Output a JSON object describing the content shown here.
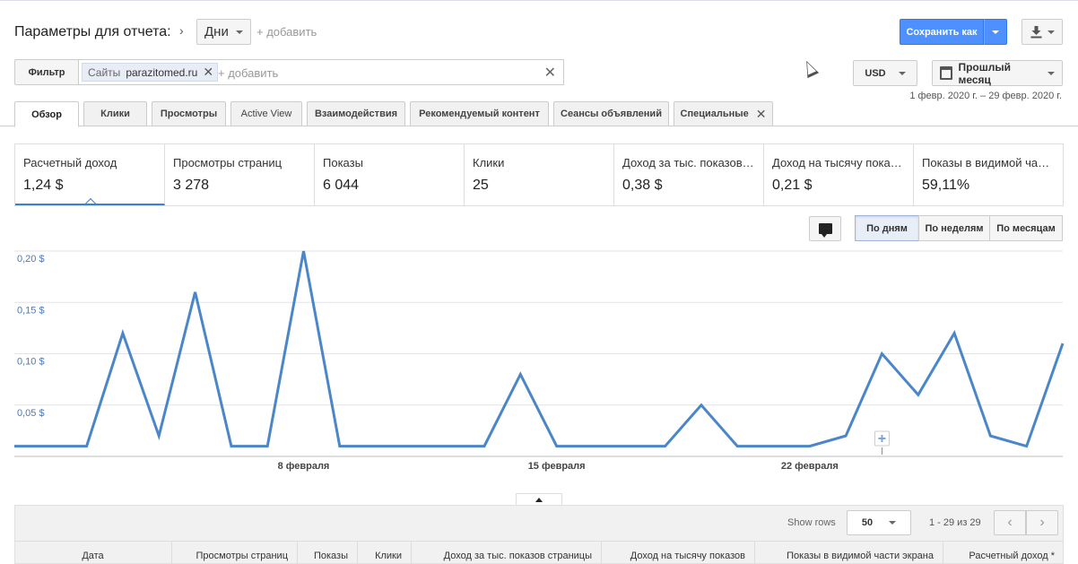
{
  "header": {
    "title": "Параметры для отчета:",
    "dimension_dropdown": "Дни",
    "add_label": "+ добавить",
    "save_as_label": "Сохранить как"
  },
  "filter": {
    "button_label": "Фильтр",
    "chip_label": "Сайты",
    "chip_value": "parazitomed.ru",
    "add_label": "+ добавить"
  },
  "currency": "USD",
  "period": {
    "label": "Прошлый месяц",
    "range": "1 февр. 2020 г. – 29 февр. 2020 г."
  },
  "tabs": [
    {
      "label": "Обзор"
    },
    {
      "label": "Клики"
    },
    {
      "label": "Просмотры"
    },
    {
      "label": "Active View"
    },
    {
      "label": "Взаимодействия"
    },
    {
      "label": "Рекомендуемый контент"
    },
    {
      "label": "Сеансы объявлений"
    },
    {
      "label": "Специальные"
    }
  ],
  "metrics": [
    {
      "name": "Расчетный доход",
      "value": "1,24 $"
    },
    {
      "name": "Просмотры страниц",
      "value": "3 278"
    },
    {
      "name": "Показы",
      "value": "6 044"
    },
    {
      "name": "Клики",
      "value": "25"
    },
    {
      "name": "Доход за тыс. показов страницы",
      "value": "0,38 $"
    },
    {
      "name": "Доход на тысячу показов",
      "value": "0,21 $"
    },
    {
      "name": "Показы в видимой части экрана",
      "value": "59,11%"
    }
  ],
  "granularity": {
    "day": "По дням",
    "week": "По неделям",
    "month": "По месяцам"
  },
  "colors": {
    "accent": "#4d90fe",
    "line": "#4a86c8",
    "axis_text": "#4a7ab8"
  },
  "chart_data": {
    "type": "line",
    "title": "",
    "xlabel": "",
    "ylabel": "",
    "ylim": [
      0,
      0.2
    ],
    "y_ticks": [
      {
        "value": 0.2,
        "label": "0,20 $"
      },
      {
        "value": 0.15,
        "label": "0,15 $"
      },
      {
        "value": 0.1,
        "label": "0,10 $"
      },
      {
        "value": 0.05,
        "label": "0,05 $"
      }
    ],
    "x_ticks": [
      {
        "day": 8,
        "label": "8 февраля"
      },
      {
        "day": 15,
        "label": "15 февраля"
      },
      {
        "day": 22,
        "label": "22 февраля"
      }
    ],
    "x": [
      1,
      2,
      3,
      4,
      5,
      6,
      7,
      8,
      9,
      10,
      11,
      12,
      13,
      14,
      15,
      16,
      17,
      18,
      19,
      20,
      21,
      22,
      23,
      24,
      25,
      26,
      27,
      28,
      29
    ],
    "series": [
      {
        "values": [
          0.01,
          0.01,
          0.01,
          0.12,
          0.02,
          0.16,
          0.01,
          0.01,
          0.2,
          0.01,
          0.01,
          0.01,
          0.01,
          0.01,
          0.08,
          0.01,
          0.01,
          0.01,
          0.01,
          0.05,
          0.01,
          0.01,
          0.01,
          0.02,
          0.1,
          0.06,
          0.12,
          0.02,
          0.01,
          0.11
        ]
      }
    ],
    "grid": true,
    "annotation_marker_day": 24
  },
  "table": {
    "show_rows_label": "Show rows",
    "rows_value": "50",
    "range_label": "1 - 29 из 29",
    "columns": [
      "Дата",
      "Просмотры страниц",
      "Показы",
      "Клики",
      "Доход за тыс. показов страницы",
      "Доход на тысячу показов",
      "Показы в видимой части экрана",
      "Расчетный доход *"
    ]
  }
}
